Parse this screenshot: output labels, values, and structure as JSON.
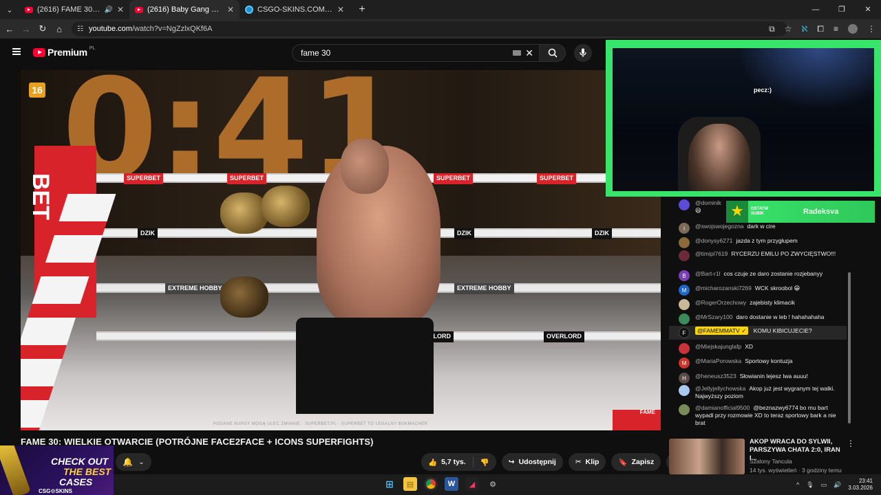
{
  "browser": {
    "tabs": [
      {
        "label": "(2616) FAME 30: WIELKIE O",
        "favicon": "youtube-icon",
        "active": false,
        "audio": true
      },
      {
        "label": "(2616) Baby Gang – Mentalité |",
        "favicon": "youtube-icon",
        "active": true
      },
      {
        "label": "CSGO-SKINS.COM - Najlepsze",
        "favicon": "csgo-skins-icon",
        "active": false
      }
    ],
    "url_host": "youtube.com",
    "url_path": "/watch?v=NgZzlxQKf6A"
  },
  "youtube": {
    "logo_text": "Premium",
    "logo_region": "PL",
    "search_value": "fame 30"
  },
  "video": {
    "age_rating": "16",
    "big_text": "0:41",
    "brand_superbet": "SUPERBET",
    "brand_dzik": "DZIK",
    "brand_extreme": "EXTREME HOBBY",
    "brand_overlord": "OVERLORD",
    "brand_corner": "BET",
    "fame_mark": "FAME",
    "disclaimer": "PODANE KURSY MOGĄ ULEC ZMIANIE · SUPERBET.PL · SUPERBET TO LEGALNY BUKMACHER"
  },
  "facecam": {
    "caption": "pecz:)",
    "sub_banner_type": "OSTATNI SUBIK",
    "sub_banner_name": "Radeksva"
  },
  "chat": {
    "messages": [
      {
        "user": "@dominik",
        "text": "😆",
        "avatar_color": "#5b4bd6",
        "avatar_letter": ""
      },
      {
        "user": "@swojswojegozna",
        "text": "dark w cire",
        "avatar_color": "#7a6a5a",
        "avatar_letter": "i"
      },
      {
        "user": "@donysy6271",
        "text": "jazda z tym przygłupem",
        "avatar_color": "#8a6a3a",
        "avatar_letter": ""
      },
      {
        "user": "@timipl7619",
        "text": "RYCERZU EMILU PO ZWYCIĘSTWO!!!",
        "avatar_color": "#6a2a3a",
        "avatar_letter": ""
      },
      {
        "user": "@Bart-r1l",
        "text": "cos czuje ze daro zostanie rozjebanyy",
        "avatar_color": "#7b3fb5",
        "avatar_letter": "B"
      },
      {
        "user": "@micharozanski7269",
        "text": "WCK skroobol 😁",
        "avatar_color": "#1e66c8",
        "avatar_letter": "M"
      },
      {
        "user": "@RogerOrzechowy",
        "text": "zajebisty klimacik",
        "avatar_color": "#c9b99a",
        "avatar_letter": ""
      },
      {
        "user": "@MrSzary100",
        "text": "daro dostanie w leb ! hahahahaha",
        "avatar_color": "#3a8a5a",
        "avatar_letter": ""
      },
      {
        "user": "@FAMEMMATV ✓",
        "text": "KOMU KIBICUJECIE?",
        "avatar_color": "#111111",
        "avatar_letter": "F",
        "moderator": true
      },
      {
        "user": "@Miejskajunglafp",
        "text": "XD",
        "avatar_color": "#c8323a",
        "avatar_letter": ""
      },
      {
        "user": "@MariaPorowska",
        "text": "Sportowy kontuzja",
        "avatar_color": "#c8352a",
        "avatar_letter": "M"
      },
      {
        "user": "@heneusz3523",
        "text": "Słowianin lejesz lwa auuu!",
        "avatar_color": "#5a4a4a",
        "avatar_letter": "H"
      },
      {
        "user": "@Jellyjellychowska",
        "text": "Akop już jest wygranym tej walki. Najwyższy poziom",
        "avatar_color": "#a8c8f0",
        "avatar_letter": ""
      },
      {
        "user": "@damianofficial9500",
        "text": "@beznazwy6774 bo mu bart wypadl przy rozmowie XD to teraz sportowy bark a nie brat",
        "avatar_color": "#7a8a5a",
        "avatar_letter": ""
      }
    ]
  },
  "info": {
    "title": "FAME 30: WIELKIE OTWARCIE (POTRÓJNE FACE2FACE + ICONS SUPERFIGHTS)",
    "likes": "5,7 tys.",
    "share": "Udostępnij",
    "clip": "Klip",
    "save": "Zapisz"
  },
  "ad": {
    "line1": "CHECK OUT",
    "line2": "THE BEST",
    "line3": "CASES",
    "brand": "CSG⚙SKINS"
  },
  "recommended": {
    "title": "AKOP WRACA DO SYLWII, PARSZYWA CHATA 2:0, IRAN I...",
    "channel": "Szalony Tancula",
    "meta": "14 tys. wyświetleń · 3 godziny temu"
  },
  "taskbar": {
    "time": "23:41",
    "date": "3.03.2026"
  }
}
